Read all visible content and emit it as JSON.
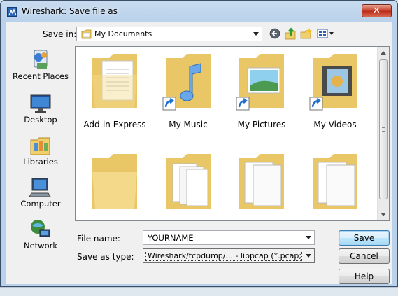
{
  "window": {
    "title": "Wireshark: Save file as",
    "close_label": "✕"
  },
  "savein": {
    "label": "Save in:",
    "value": "My Documents"
  },
  "places": [
    {
      "label": "Recent Places",
      "icon": "recent-places-icon"
    },
    {
      "label": "Desktop",
      "icon": "desktop-icon"
    },
    {
      "label": "Libraries",
      "icon": "libraries-icon"
    },
    {
      "label": "Computer",
      "icon": "computer-icon"
    },
    {
      "label": "Network",
      "icon": "network-icon"
    }
  ],
  "items": [
    {
      "name": "Add-in Express",
      "kind": "folder-documents",
      "shortcut": false
    },
    {
      "name": "My Music",
      "kind": "folder-music",
      "shortcut": true
    },
    {
      "name": "My Pictures",
      "kind": "folder-pictures",
      "shortcut": true
    },
    {
      "name": "My Videos",
      "kind": "folder-videos",
      "shortcut": true
    },
    {
      "name": "",
      "kind": "folder-empty",
      "shortcut": false
    },
    {
      "name": "",
      "kind": "folder-files",
      "shortcut": false
    },
    {
      "name": "",
      "kind": "folder-papers",
      "shortcut": false
    },
    {
      "name": "",
      "kind": "folder-papers",
      "shortcut": false
    }
  ],
  "form": {
    "filename_label": "File name:",
    "filename_value": "YOURNAME",
    "savetype_label": "Save as type:",
    "savetype_value": "Wireshark/tcpdump/... - libpcap (*.pcap;*.pcap"
  },
  "buttons": {
    "save": "Save",
    "cancel": "Cancel",
    "help": "Help"
  },
  "colors": {
    "folder": "#f2d98a",
    "shortcut": "#1e6fd0",
    "accent": "#3c7fb1"
  }
}
